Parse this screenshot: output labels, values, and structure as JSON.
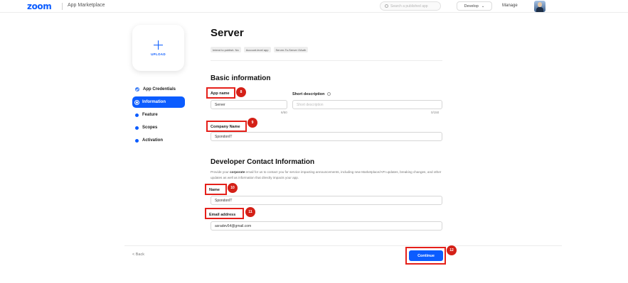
{
  "header": {
    "logo": "zoom",
    "section": "App Marketplace",
    "search_placeholder": "Search a published app",
    "develop_label": "Develop",
    "manage_label": "Manage"
  },
  "upload": {
    "label": "UPLOAD"
  },
  "sidebar": {
    "items": [
      {
        "label": "App Credentials",
        "state": "completed"
      },
      {
        "label": "Information",
        "state": "active"
      },
      {
        "label": "Feature",
        "state": "pending"
      },
      {
        "label": "Scopes",
        "state": "pending"
      },
      {
        "label": "Activation",
        "state": "pending"
      }
    ]
  },
  "main": {
    "title": "Server",
    "tags": [
      "Intend to publish: No",
      "Account-level app",
      "Server-To-Server OAuth"
    ],
    "basic": {
      "title": "Basic information",
      "app_name_label": "App name",
      "app_name_value": "Server",
      "app_name_counter": "6/50",
      "short_desc_label": "Short description",
      "short_desc_placeholder": "Short description",
      "short_desc_counter": "0/150",
      "company_label": "Company Name",
      "company_value": "SpondonIT"
    },
    "developer": {
      "title": "Developer Contact Information",
      "desc_pre": "Provide your ",
      "desc_bold": "corporate",
      "desc_post": " email for us to contact you for service impacting announcements, including new Marketplace/API updates, breaking changes, and other updates as well as information that directly impacts your app.",
      "name_label": "Name",
      "name_value": "SpondonIT",
      "email_label": "Email address",
      "email_value": "asradev54@gmail.com"
    }
  },
  "footer": {
    "back_label": "< Back",
    "continue_label": "Continue"
  },
  "annotations": [
    "8",
    "9",
    "10",
    "11",
    "12"
  ],
  "colors": {
    "accent": "#0b5cff",
    "highlight": "#e5201a"
  }
}
